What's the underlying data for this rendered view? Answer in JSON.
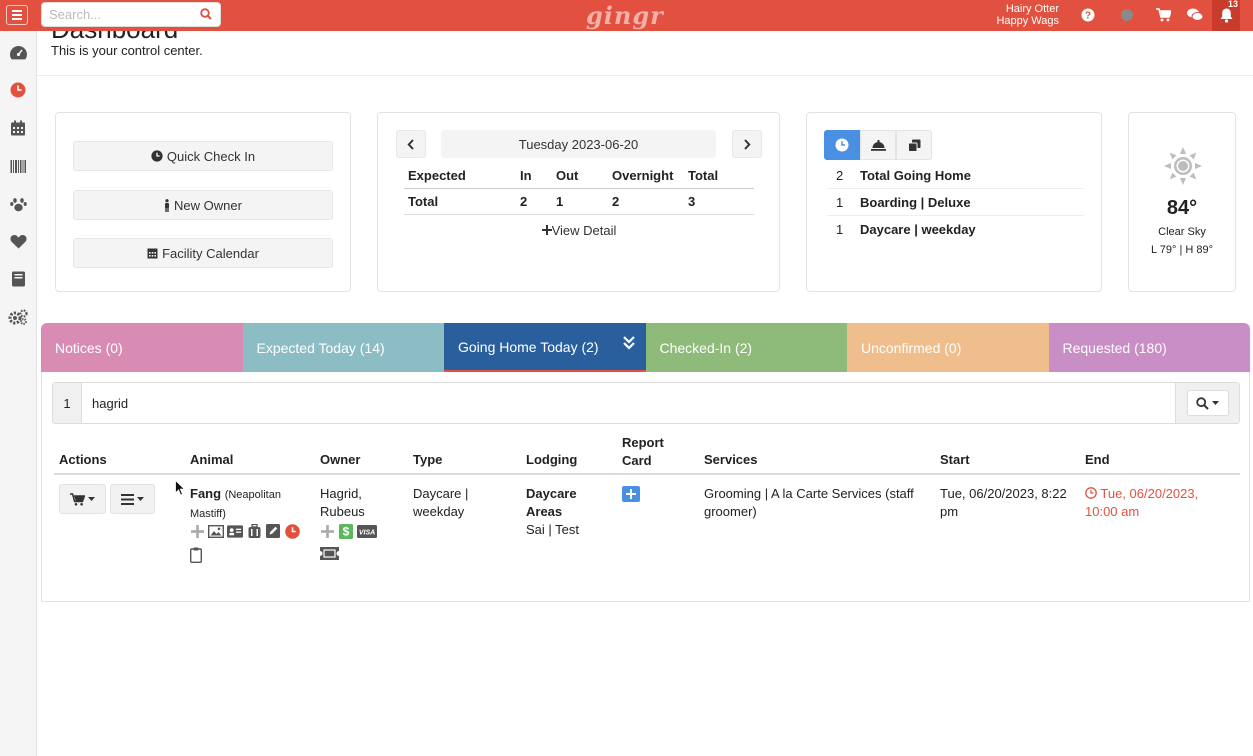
{
  "topbar": {
    "search_placeholder": "Search...",
    "logo": "gingr",
    "user_name": "Hairy Otter",
    "facility_name": "Happy Wags",
    "notification_count": "13"
  },
  "sidebar": {
    "items": [
      {
        "icon": "dashboard-gauge-icon"
      },
      {
        "icon": "clock-icon",
        "active": true
      },
      {
        "icon": "calendar-icon"
      },
      {
        "icon": "barcode-icon"
      },
      {
        "icon": "paw-icon"
      },
      {
        "icon": "heart-icon"
      },
      {
        "icon": "book-icon"
      },
      {
        "icon": "gears-icon"
      }
    ]
  },
  "header": {
    "title": "Dashboard",
    "subtitle": "This is your control center."
  },
  "quick_actions": {
    "check_in": "Quick Check In",
    "new_owner": "New Owner",
    "facility_calendar": "Facility Calendar"
  },
  "stats": {
    "date": "Tuesday 2023-06-20",
    "columns": [
      "Expected",
      "In",
      "Out",
      "Overnight",
      "Total"
    ],
    "row": {
      "label": "Total",
      "in": "2",
      "out": "1",
      "overnight": "2",
      "total": "3"
    },
    "view_detail": "View Detail"
  },
  "going_home": {
    "rows": [
      {
        "count": "2",
        "label": "Total Going Home"
      },
      {
        "count": "1",
        "label": "Boarding | Deluxe"
      },
      {
        "count": "1",
        "label": "Daycare | weekday"
      }
    ]
  },
  "weather": {
    "temp": "84°",
    "condition": "Clear Sky",
    "low_high": "L 79° | H 89°"
  },
  "tabs": [
    {
      "label": "Notices (0)",
      "color": "#d98cb3"
    },
    {
      "label": "Expected Today (14)",
      "color": "#8dbdc4"
    },
    {
      "label": "Going Home Today (2)",
      "color": "#2a5f9e",
      "active": true
    },
    {
      "label": "Checked-In (2)",
      "color": "#8fbb7a"
    },
    {
      "label": "Unconfirmed (0)",
      "color": "#f0bd8c"
    },
    {
      "label": "Requested (180)",
      "color": "#c98ec6"
    }
  ],
  "filter": {
    "count": "1",
    "value": "hagrid"
  },
  "table": {
    "headers": {
      "actions": "Actions",
      "animal": "Animal",
      "owner": "Owner",
      "type": "Type",
      "lodging": "Lodging",
      "report_card_1": "Report",
      "report_card_2": "Card",
      "services": "Services",
      "start": "Start",
      "end": "End"
    },
    "row": {
      "animal_name": "Fang",
      "animal_breed_1": "(Neapolitan",
      "animal_breed_2": "Mastiff)",
      "owner_1": "Hagrid,",
      "owner_2": "Rubeus",
      "type_1": "Daycare |",
      "type_2": "weekday",
      "lodging_1": "Daycare",
      "lodging_2": "Areas",
      "lodging_3": "Sai | Test",
      "services_1": "Grooming | A la Carte Services (staff",
      "services_2": "groomer)",
      "start_1": "Tue, 06/20/2023, 8:22",
      "start_2": "pm",
      "end_1": "Tue, 06/20/2023,",
      "end_2": "10:00 am"
    }
  },
  "colors": {
    "brand": "#e2513f",
    "accent_blue": "#4a90e2",
    "end_red": "#e2513f"
  }
}
